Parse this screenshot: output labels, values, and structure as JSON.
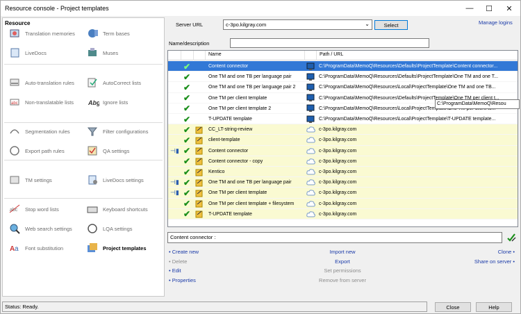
{
  "window": {
    "title": "Resource console - Project templates",
    "minimize_glyph": "—",
    "maximize_glyph": "☐",
    "close_glyph": "✕"
  },
  "left_panel": {
    "header": "Resource",
    "items": [
      {
        "label": "Translation memories",
        "icon": "translation-memories-icon"
      },
      {
        "label": "Term bases",
        "icon": "term-bases-icon"
      },
      {
        "label": "LiveDocs",
        "icon": "livedocs-icon"
      },
      {
        "label": "Muses",
        "icon": "muses-icon"
      },
      {
        "label": "Auto-translation rules",
        "icon": "auto-translation-rules-icon"
      },
      {
        "label": "AutoCorrect lists",
        "icon": "autocorrect-lists-icon"
      },
      {
        "label": "Non-translatable lists",
        "icon": "non-translatable-lists-icon"
      },
      {
        "label": "Ignore lists",
        "icon": "ignore-lists-icon"
      },
      {
        "label": "Segmentation rules",
        "icon": "segmentation-rules-icon"
      },
      {
        "label": "Filter configurations",
        "icon": "filter-configurations-icon"
      },
      {
        "label": "Export path rules",
        "icon": "export-path-rules-icon"
      },
      {
        "label": "QA settings",
        "icon": "qa-settings-icon"
      },
      {
        "label": "TM settings",
        "icon": "tm-settings-icon"
      },
      {
        "label": "LiveDocs settings",
        "icon": "livedocs-settings-icon"
      },
      {
        "label": "Stop word lists",
        "icon": "stop-word-lists-icon"
      },
      {
        "label": "Keyboard shortcuts",
        "icon": "keyboard-shortcuts-icon"
      },
      {
        "label": "Web search settings",
        "icon": "web-search-settings-icon"
      },
      {
        "label": "LQA settings",
        "icon": "lqa-settings-icon"
      },
      {
        "label": "Font substitution",
        "icon": "font-substitution-icon"
      },
      {
        "label": "Project templates",
        "icon": "project-templates-icon"
      }
    ]
  },
  "server": {
    "label": "Server URL",
    "value": "c-3po.kilgray.com",
    "select_button": "Select",
    "manage_logins": "Manage logins"
  },
  "filter": {
    "label": "Name/description",
    "value": ""
  },
  "grid": {
    "columns": [
      "Name",
      "Path / URL"
    ],
    "rows": [
      {
        "name": "Content connector",
        "path": "C:\\ProgramData\\MemoQ\\Resources\\Defaults\\ProjectTemplate\\Content connector...",
        "type": "local",
        "selected": true,
        "pinned": false
      },
      {
        "name": "One TM and one TB per language pair",
        "path": "C:\\ProgramData\\MemoQ\\Resources\\Defaults\\ProjectTemplate\\One TM and one T...",
        "type": "local",
        "selected": false,
        "pinned": false
      },
      {
        "name": "One TM and one TB per language pair 2",
        "path": "C:\\ProgramData\\MemoQ\\Resources\\Local\\ProjectTemplate\\One TM and one TB...",
        "type": "local",
        "selected": false,
        "pinned": false
      },
      {
        "name": "One TM per client template",
        "path": "C:\\ProgramData\\MemoQ\\Resources\\Defaults\\ProjectTemplate\\One TM per client t...",
        "type": "local",
        "selected": false,
        "pinned": false
      },
      {
        "name": "One TM per client template 2",
        "path": "C:\\ProgramData\\MemoQ\\Resources\\Local\\ProjectTemplate\\One TM per client te...",
        "type": "local",
        "selected": false,
        "pinned": false
      },
      {
        "name": "T-UPDATE template",
        "path": "C:\\ProgramData\\MemoQ\\Resources\\Local\\ProjectTemplate\\T-UPDATE template...",
        "type": "local",
        "selected": false,
        "pinned": false
      },
      {
        "name": "CC_LT-string-review",
        "path": "c-3po.kilgray.com",
        "type": "server",
        "selected": false,
        "pinned": false
      },
      {
        "name": "client-template",
        "path": "c-3po.kilgray.com",
        "type": "server",
        "selected": false,
        "pinned": false
      },
      {
        "name": "Content connector",
        "path": "c-3po.kilgray.com",
        "type": "server",
        "selected": false,
        "pinned": true
      },
      {
        "name": "Content connector - copy",
        "path": "c-3po.kilgray.com",
        "type": "server",
        "selected": false,
        "pinned": false
      },
      {
        "name": "Kentico",
        "path": "c-3po.kilgray.com",
        "type": "server",
        "selected": false,
        "pinned": false
      },
      {
        "name": "One TM and one TB per language pair",
        "path": "c-3po.kilgray.com",
        "type": "server",
        "selected": false,
        "pinned": true
      },
      {
        "name": "One TM per client template",
        "path": "c-3po.kilgray.com",
        "type": "server",
        "selected": false,
        "pinned": true
      },
      {
        "name": "One TM per client template + filesystem",
        "path": "c-3po.kilgray.com",
        "type": "server",
        "selected": false,
        "pinned": false
      },
      {
        "name": "T-UPDATE template",
        "path": "c-3po.kilgray.com",
        "type": "server",
        "selected": false,
        "pinned": false
      }
    ]
  },
  "tooltip": "C:\\ProgramData\\MemoQ\\Resou",
  "details": {
    "value": "Content connector :"
  },
  "actions": {
    "left": [
      {
        "label": "• Create new",
        "enabled": true
      },
      {
        "label": "• Delete",
        "enabled": false
      },
      {
        "label": "• Edit",
        "enabled": true
      },
      {
        "label": "• Properties",
        "enabled": true
      }
    ],
    "middle": [
      {
        "label": "Import new",
        "enabled": true
      },
      {
        "label": "Export",
        "enabled": true
      },
      {
        "label": "Set permissions",
        "enabled": false
      },
      {
        "label": "Remove from server",
        "enabled": false
      }
    ],
    "right": [
      {
        "label": "Clone •",
        "enabled": true
      },
      {
        "label": "Share on server •",
        "enabled": true
      }
    ]
  },
  "status": "Status: Ready.",
  "footer": {
    "close": "Close",
    "help": "Help"
  },
  "colors": {
    "selection": "#3278d6",
    "server_row": "#fafad2",
    "link": "#1a3aa8",
    "check": "#1b8f1b"
  }
}
